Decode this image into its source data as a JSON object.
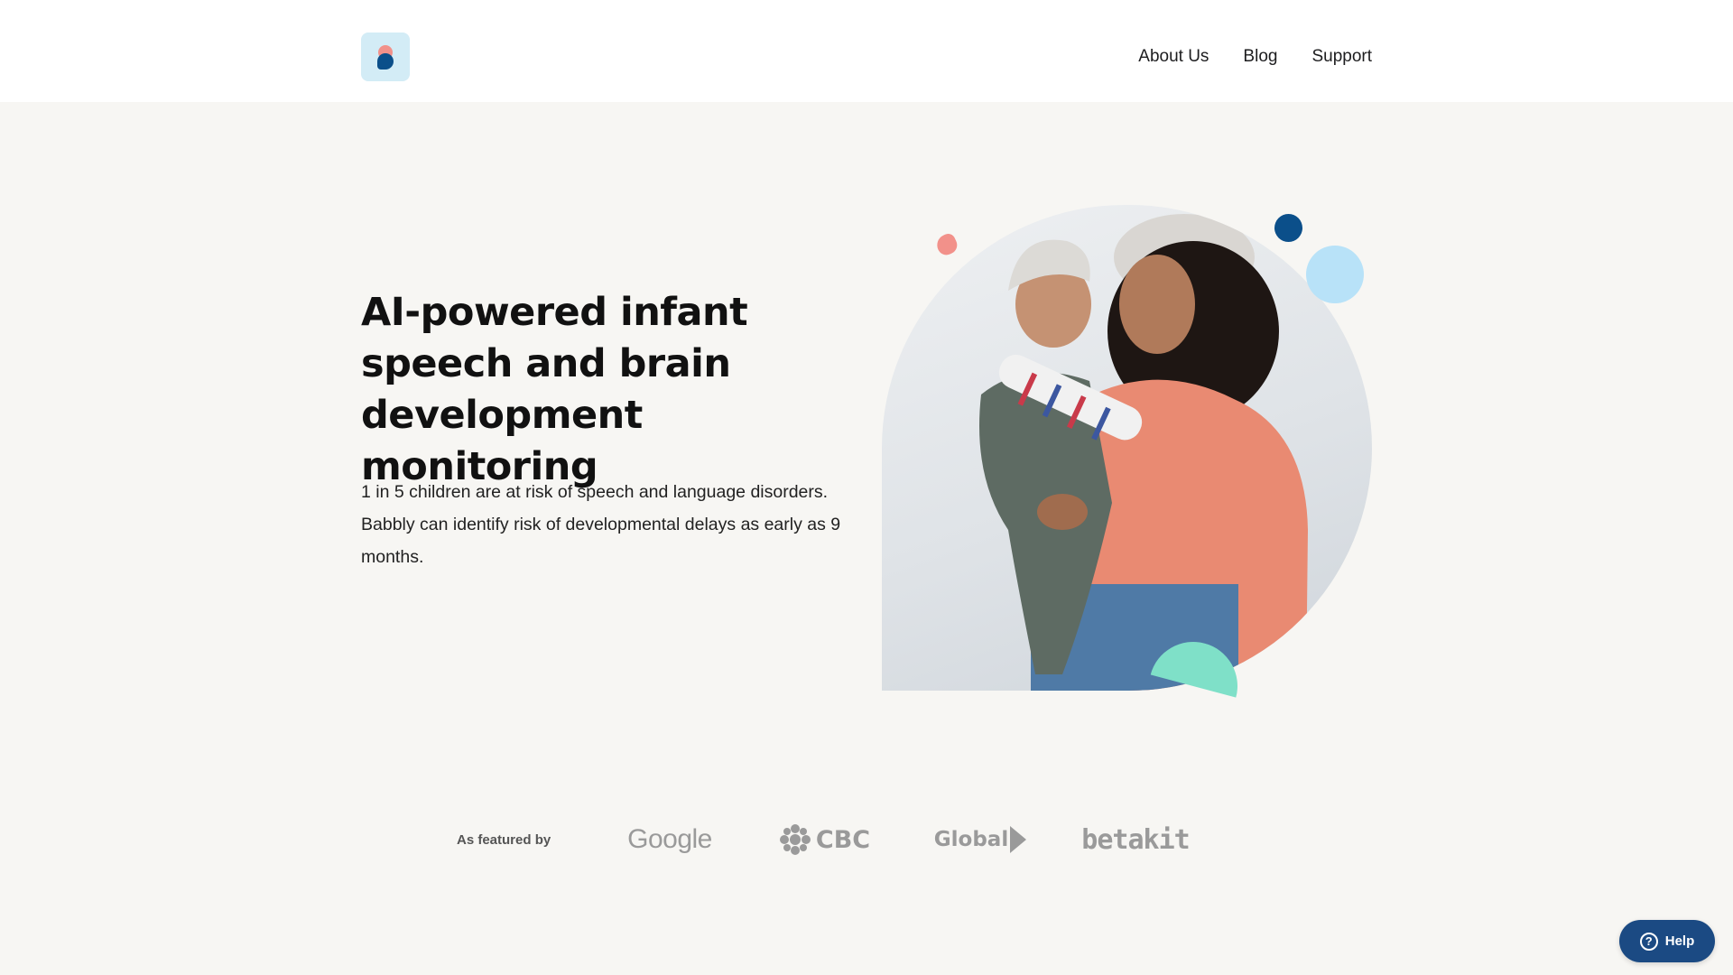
{
  "header": {
    "logo_icon": "babbly-logo-icon",
    "nav": [
      {
        "label": "About Us"
      },
      {
        "label": "Blog"
      },
      {
        "label": "Support"
      }
    ]
  },
  "hero": {
    "title": "AI-powered infant speech and brain development monitoring",
    "body": "1 in 5 children are at risk of speech and language disorders. Babbly can identify risk of developmental delays as early as 9 months."
  },
  "featured": {
    "label": "As featured by",
    "logos": [
      {
        "text": "Google"
      },
      {
        "text": "CBC"
      },
      {
        "text": "Global"
      },
      {
        "text": "betakit"
      }
    ]
  },
  "help_button": {
    "label": "Help",
    "icon": "question-circle-icon"
  },
  "colors": {
    "page_background": "#f7f6f3",
    "brand_navy": "#0b4f8a",
    "brand_coral": "#f2918a",
    "brand_sky": "#b8e2f8",
    "brand_mint": "#7fe0c8",
    "help_button": "#1b4a83"
  }
}
